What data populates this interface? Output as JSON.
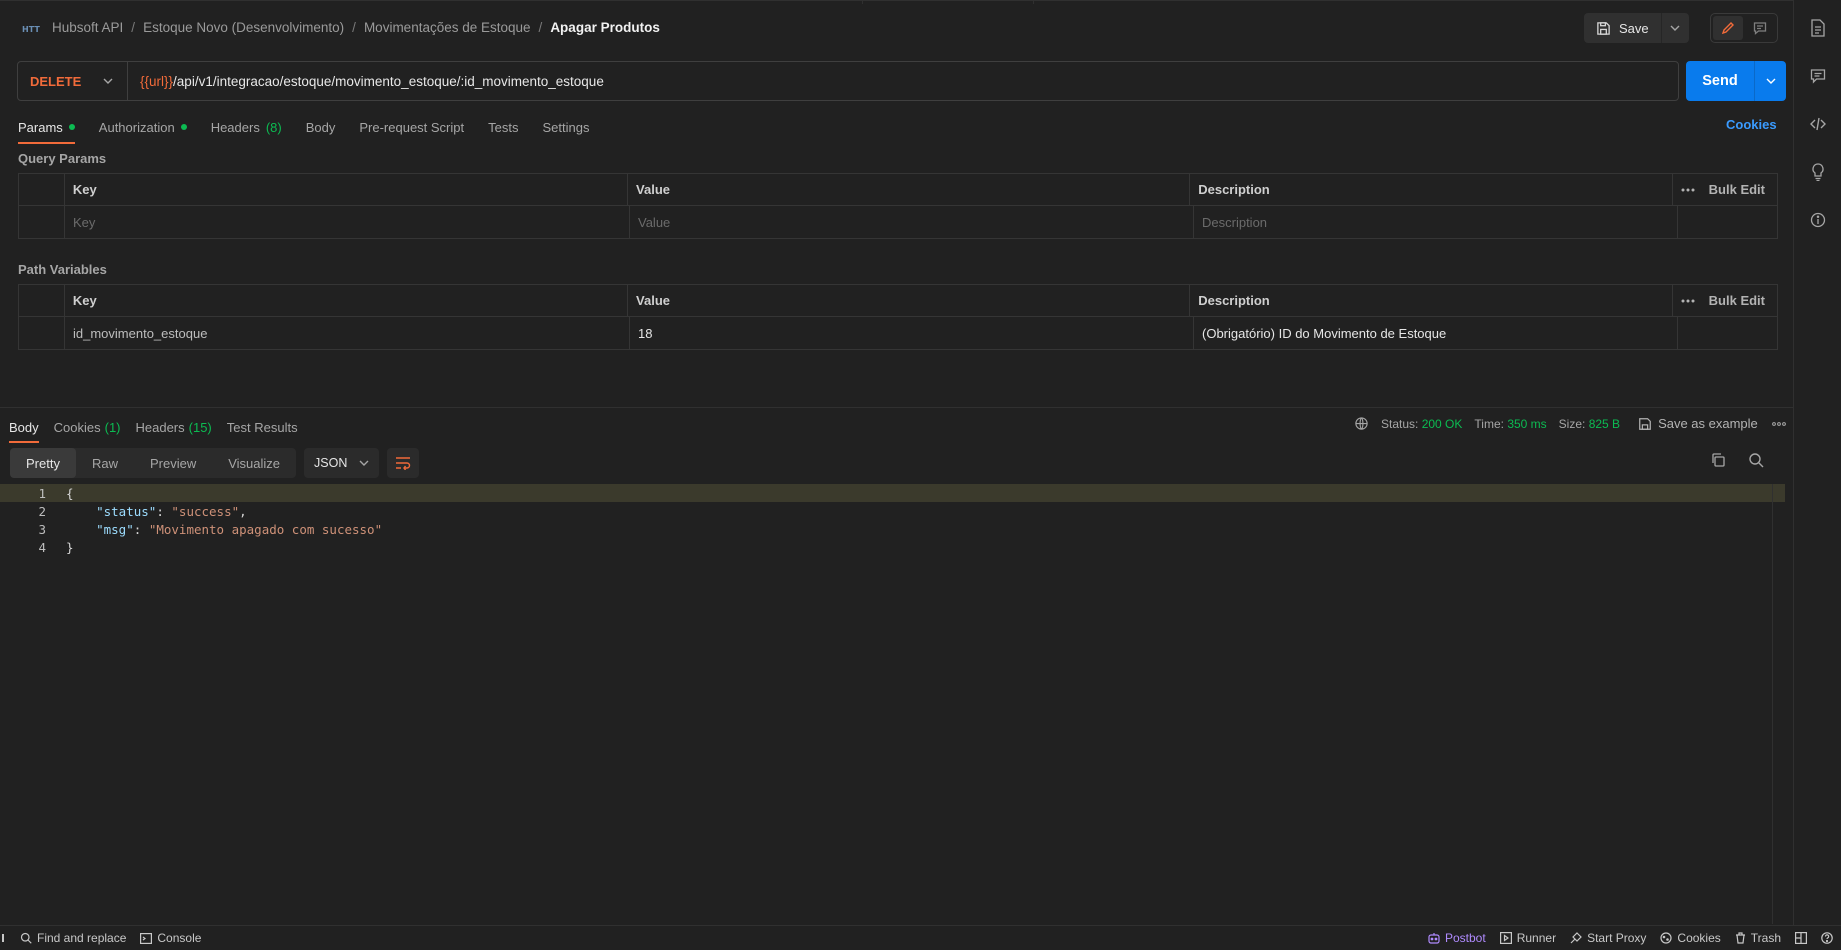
{
  "breadcrumb": {
    "items": [
      "Hubsoft API",
      "Estoque Novo (Desenvolvimento)",
      "Movimentações de Estoque"
    ],
    "separator": "/",
    "current": "Apagar Produtos"
  },
  "toolbar": {
    "save_label": "Save"
  },
  "request": {
    "method": "DELETE",
    "url_var": "{{url}}",
    "url_path": "/api/v1/integracao/estoque/movimento_estoque/:id_movimento_estoque",
    "send_label": "Send"
  },
  "request_tabs": [
    {
      "label": "Params",
      "dot": true,
      "active": true
    },
    {
      "label": "Authorization",
      "dot": true
    },
    {
      "label": "Headers",
      "count": "(8)"
    },
    {
      "label": "Body"
    },
    {
      "label": "Pre-request Script"
    },
    {
      "label": "Tests"
    },
    {
      "label": "Settings"
    }
  ],
  "cookies_link": "Cookies",
  "query_params": {
    "title": "Query Params",
    "columns": [
      "Key",
      "Value",
      "Description"
    ],
    "bulk_edit": "Bulk Edit",
    "placeholders": {
      "key": "Key",
      "value": "Value",
      "description": "Description"
    }
  },
  "path_variables": {
    "title": "Path Variables",
    "columns": [
      "Key",
      "Value",
      "Description"
    ],
    "bulk_edit": "Bulk Edit",
    "rows": [
      {
        "key": "id_movimento_estoque",
        "value": "18",
        "description": "(Obrigatório) ID do Movimento de Estoque"
      }
    ]
  },
  "response_tabs": [
    {
      "label": "Body",
      "active": true
    },
    {
      "label": "Cookies",
      "count": "(1)"
    },
    {
      "label": "Headers",
      "count": "(15)"
    },
    {
      "label": "Test Results"
    }
  ],
  "response_meta": {
    "status_label": "Status:",
    "status_value": "200 OK",
    "time_label": "Time:",
    "time_value": "350 ms",
    "size_label": "Size:",
    "size_value": "825 B",
    "save_example": "Save as example"
  },
  "format_tabs": [
    "Pretty",
    "Raw",
    "Preview",
    "Visualize"
  ],
  "format_select": "JSON",
  "code_lines": [
    {
      "n": "1",
      "text": "{"
    },
    {
      "n": "2",
      "key": "\"status\"",
      "value": "\"success\"",
      "trail": ","
    },
    {
      "n": "3",
      "key": "\"msg\"",
      "value": "\"Movimento apagado com sucesso\"",
      "trail": ""
    },
    {
      "n": "4",
      "text": "}"
    }
  ],
  "footer": {
    "left": [
      "Find and replace",
      "Console"
    ],
    "right": [
      "Postbot",
      "Runner",
      "Start Proxy",
      "Cookies",
      "Trash"
    ]
  },
  "colors": {
    "accent": "#f26b3a",
    "send": "#097bed",
    "success": "#0cbb52",
    "link": "#3a9bff"
  }
}
